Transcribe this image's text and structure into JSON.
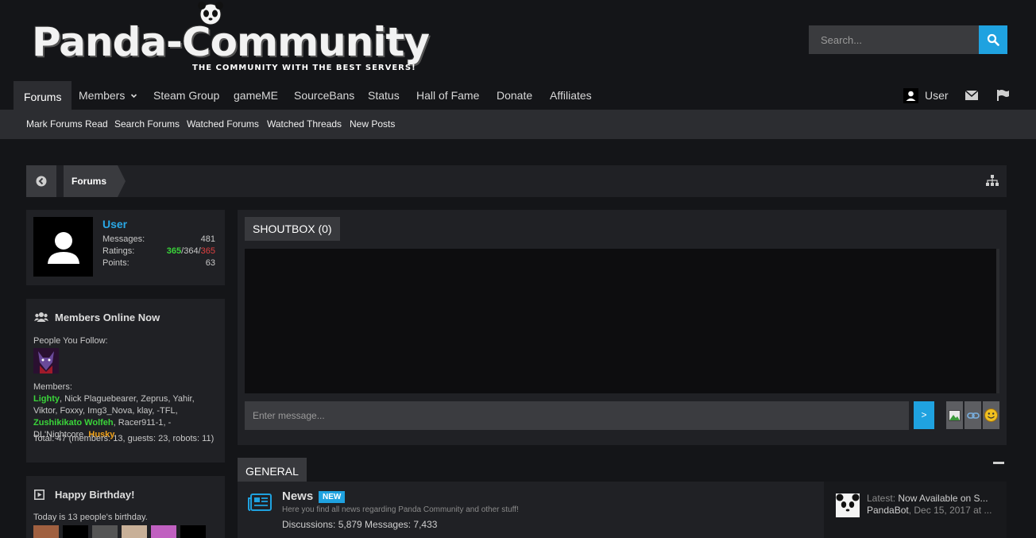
{
  "header": {
    "logo_text": "Panda-Community",
    "tagline": "THE COMMUNITY WITH THE BEST SERVERS!",
    "search_placeholder": "Search..."
  },
  "nav": {
    "items": [
      "Forums",
      "Members",
      "Steam Group",
      "gameME",
      "SourceBans",
      "Status",
      "Hall of Fame",
      "Donate",
      "Affiliates"
    ],
    "user_label": "User"
  },
  "subnav": {
    "items": [
      "Mark Forums Read",
      "Search Forums",
      "Watched Forums",
      "Watched Threads",
      "New Posts"
    ]
  },
  "breadcrumb": {
    "current": "Forums"
  },
  "user_panel": {
    "name": "User",
    "messages_label": "Messages:",
    "messages": "481",
    "ratings_label": "Ratings:",
    "ratings_pos": "365",
    "ratings_neu": "364",
    "ratings_neg": "365",
    "points_label": "Points:",
    "points": "63"
  },
  "members_online": {
    "title": "Members Online Now",
    "follow_label": "People You Follow:",
    "members_label": "Members:",
    "members": [
      {
        "name": "Lighty",
        "style": "green"
      },
      {
        "name": "Nick Plaguebearer",
        "style": "normal"
      },
      {
        "name": "Zeprus",
        "style": "normal"
      },
      {
        "name": "Yahir",
        "style": "normal"
      },
      {
        "name": "Viktor",
        "style": "normal"
      },
      {
        "name": "Foxxy",
        "style": "normal"
      },
      {
        "name": "Img3_Nova",
        "style": "normal"
      },
      {
        "name": "klay",
        "style": "normal"
      },
      {
        "name": "-TFL",
        "style": "normal"
      },
      {
        "name": "Zushikikato Wolfeh",
        "style": "green"
      },
      {
        "name": "Racer911-1",
        "style": "normal"
      },
      {
        "name": "-DL'Nightcore",
        "style": "normal"
      },
      {
        "name": "Husky",
        "style": "orange"
      }
    ],
    "total": "Total: 47 (members: 13, guests: 23, robots: 11)"
  },
  "birthday": {
    "title": "Happy Birthday!",
    "text": "Today is 13 people's birthday."
  },
  "shoutbox": {
    "title": "SHOUTBOX (0)",
    "input_placeholder": "Enter message...",
    "send_label": ">"
  },
  "category": {
    "title": "GENERAL",
    "forum": {
      "title": "News",
      "badge": "NEW",
      "description": "Here you find all news regarding Panda Community and other stuff!",
      "stats": "Discussions: 5,879 Messages: 7,433",
      "latest_label": "Latest:",
      "latest_title": "Now Available on S...",
      "latest_user": "PandaBot",
      "latest_date": "Dec 15, 2017 at ..."
    }
  },
  "colors": {
    "accent": "#1fa2e0",
    "positive": "#3ad43a",
    "negative": "#e04040",
    "highlight": "#f0a21a"
  }
}
